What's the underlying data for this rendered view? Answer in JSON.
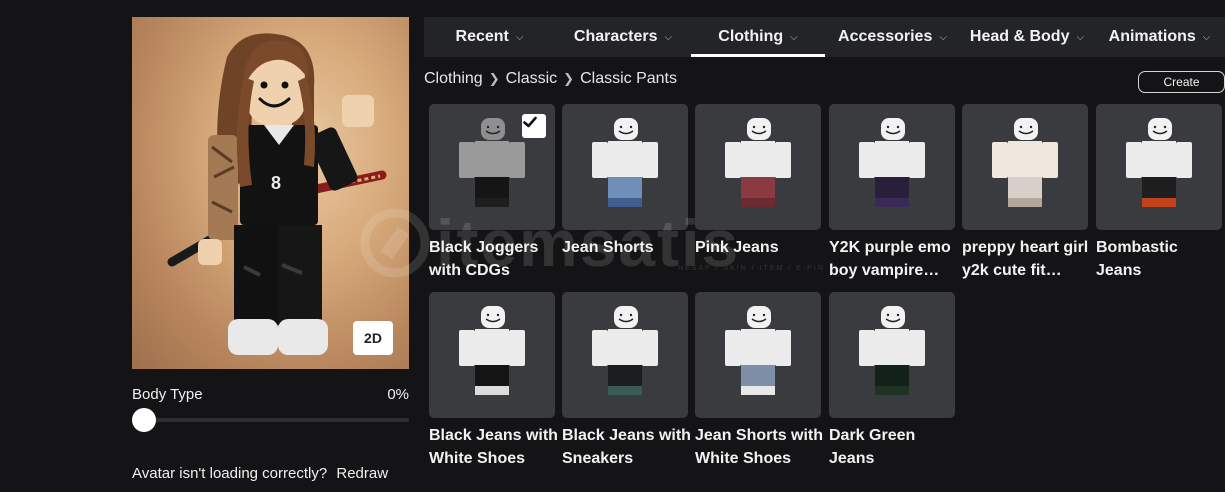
{
  "avatar": {
    "view_toggle": "2D"
  },
  "body_type": {
    "label": "Body Type",
    "value": "0%"
  },
  "redraw": {
    "message": "Avatar isn't loading correctly?",
    "link": "Redraw"
  },
  "tabs": [
    {
      "label": "Recent"
    },
    {
      "label": "Characters"
    },
    {
      "label": "Clothing",
      "active": true
    },
    {
      "label": "Accessories"
    },
    {
      "label": "Head & Body"
    },
    {
      "label": "Animations"
    }
  ],
  "breadcrumb": [
    "Clothing",
    "Classic",
    "Classic Pants"
  ],
  "create_label": "Create",
  "watermark": {
    "text": "itemsatis",
    "sub": "HESAP / SKIN / ITEM / E-PIN"
  },
  "items": [
    {
      "name": "Black Joggers with CDGs",
      "selected": true
    },
    {
      "name": "Jean Shorts"
    },
    {
      "name": "Pink Jeans"
    },
    {
      "name": "Y2K purple emo boy vampire…"
    },
    {
      "name": "preppy heart girl y2k cute fit…"
    },
    {
      "name": "Bombastic Jeans"
    },
    {
      "name": "Black Jeans with White Shoes"
    },
    {
      "name": "Black Jeans with Sneakers"
    },
    {
      "name": "Jean Shorts with White Shoes"
    },
    {
      "name": "Dark Green Jeans"
    }
  ],
  "colors": {
    "background": "#141416",
    "tab_bar": "#232427",
    "card": "#393b3f",
    "accent": "#ffffff"
  }
}
